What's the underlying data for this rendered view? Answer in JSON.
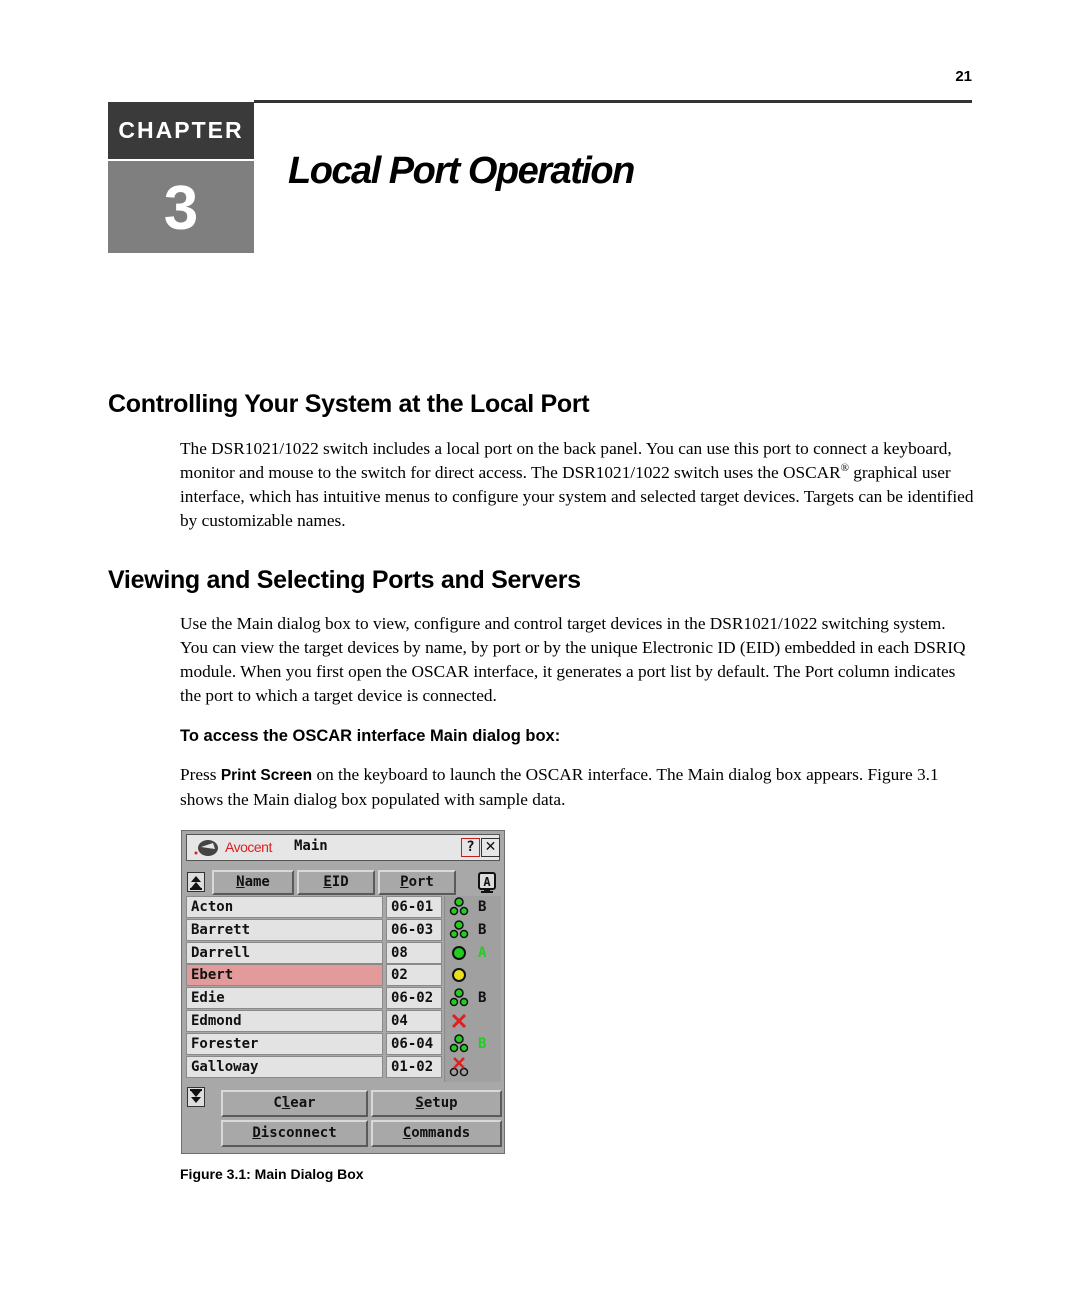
{
  "page": {
    "page_number": "21",
    "chapter_label": "CHAPTER",
    "chapter_number": "3",
    "chapter_title": "Local Port Operation"
  },
  "sections": [
    {
      "heading": "Controlling Your System at the Local Port",
      "paragraph_before_sup": "The DSR1021/1022 switch includes a local port on the back panel. You can use this port to connect a keyboard, monitor and mouse to the switch for direct access. The DSR1021/1022 switch uses the OSCAR",
      "sup": "®",
      "paragraph_after_sup": " graphical user interface, which has intuitive menus to configure your system and selected target devices. Targets can be identified by customizable names."
    },
    {
      "heading": "Viewing and Selecting Ports and Servers",
      "paragraph": "Use the Main dialog box to view, configure and control target devices in the DSR1021/1022 switching system. You can view the target devices by name, by port or by the unique Electronic ID (EID) embedded in each DSRIQ module. When you first open the OSCAR interface, it generates a port list by default. The Port column indicates the port to which a target device is connected.",
      "procedure_heading": "To access the OSCAR interface Main dialog box:",
      "step_prefix": "Press ",
      "step_key": "Print Screen",
      "step_suffix": " on the keyboard to launch the OSCAR interface. The Main dialog box appears. Figure 3.1 shows the Main dialog box populated with sample data."
    }
  ],
  "dialog": {
    "brand": "Avocent",
    "title": "Main",
    "help_label": "?",
    "close_label": "✕",
    "columns": [
      {
        "label": "Name",
        "underline": "N",
        "rest": "ame"
      },
      {
        "label": "EID",
        "underline": "E",
        "rest": "ID"
      },
      {
        "label": "Port",
        "underline": "P",
        "rest": "ort"
      }
    ],
    "view_icon": "A",
    "rows": [
      {
        "name": "Acton",
        "port": "06-01",
        "status": "tiered-online",
        "channel": "B",
        "channel_color": "#111111",
        "selected": false
      },
      {
        "name": "Barrett",
        "port": "06-03",
        "status": "tiered-online",
        "channel": "B",
        "channel_color": "#111111",
        "selected": false
      },
      {
        "name": "Darrell",
        "port": "08",
        "status": "online",
        "channel": "A",
        "channel_color": "#22cc22",
        "selected": false
      },
      {
        "name": "Ebert",
        "port": "02",
        "status": "warning",
        "channel": "",
        "channel_color": "#111111",
        "selected": true
      },
      {
        "name": "Edie",
        "port": "06-02",
        "status": "tiered-online",
        "channel": "B",
        "channel_color": "#111111",
        "selected": false
      },
      {
        "name": "Edmond",
        "port": "04",
        "status": "offline",
        "channel": "",
        "channel_color": "#111111",
        "selected": false
      },
      {
        "name": "Forester",
        "port": "06-04",
        "status": "tiered-online",
        "channel": "B",
        "channel_color": "#22cc22",
        "selected": false
      },
      {
        "name": "Galloway",
        "port": "01-02",
        "status": "tiered-offline",
        "channel": "",
        "channel_color": "#111111",
        "selected": false
      }
    ],
    "buttons": {
      "clear": {
        "pre": "C",
        "ul": "l",
        "post": "ear"
      },
      "setup": {
        "pre": "",
        "ul": "S",
        "post": "etup"
      },
      "disconnect": {
        "pre": "",
        "ul": "D",
        "post": "isconnect"
      },
      "commands": {
        "pre": "",
        "ul": "C",
        "post": "ommands"
      }
    },
    "colors": {
      "online_green": "#22cc22",
      "warning_yellow": "#e8e020",
      "offline_red": "#e02020",
      "selected_row": "#e29a9a",
      "brand_red": "#e02020"
    }
  },
  "figure_caption": "Figure 3.1: Main Dialog Box"
}
